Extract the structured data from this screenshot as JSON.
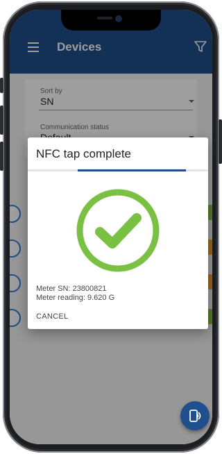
{
  "app_bar": {
    "title": "Devices",
    "menu_icon": "menu-icon",
    "filter_icon": "filter-icon"
  },
  "filters": {
    "sort_by": {
      "label": "Sort by",
      "value": "SN"
    },
    "communication_status": {
      "label": "Communication status",
      "value": "Default"
    }
  },
  "dialog": {
    "title": "NFC tap complete",
    "progress": 0.6,
    "status_icon": "check-circle-icon",
    "meter_sn": "Meter SN: 23800821",
    "meter_reading": "Meter reading: 9.620 G",
    "cancel_label": "CANCEL"
  },
  "fab": {
    "icon": "nfc-phone-icon"
  },
  "colors": {
    "primary": "#1f4f8c",
    "success": "#7ac143",
    "status_green": "#8bc34a",
    "status_orange": "#f2a531",
    "list_circle": "#2f7ed8"
  }
}
